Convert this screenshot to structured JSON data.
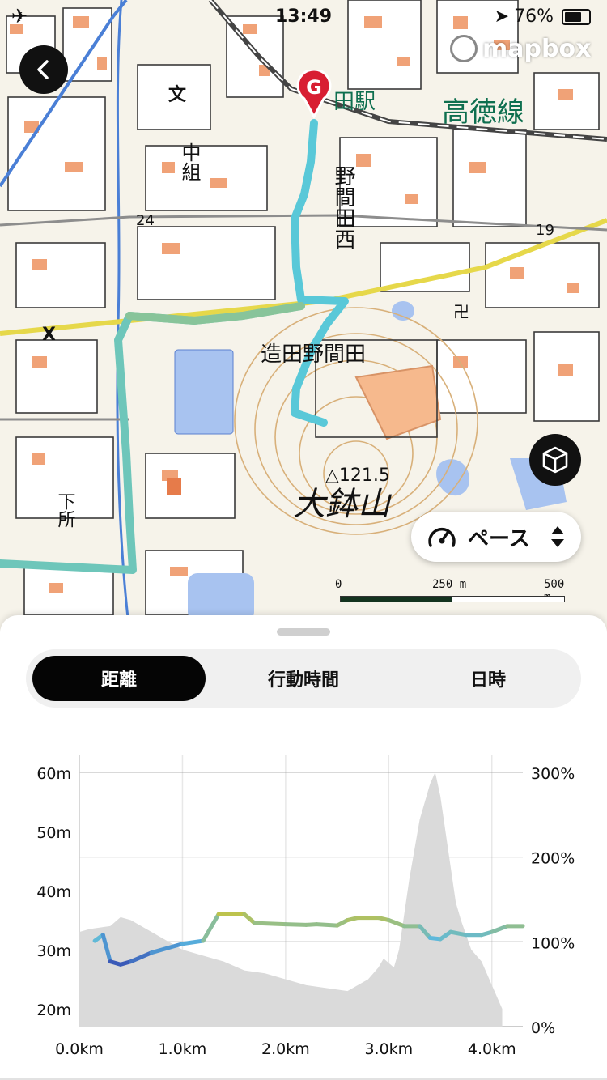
{
  "status_bar": {
    "time": "13:49",
    "battery": "76%"
  },
  "map": {
    "labels": {
      "station": "田駅",
      "line": "高徳線",
      "village": "中組",
      "district": "野間田西",
      "area": "造田野間田",
      "mountain": "大鉢山",
      "summit": "△121.5",
      "lower": "下所",
      "road_num_1": "24",
      "road_num_2": "19",
      "mark_x": "X",
      "mark_school": "文",
      "mark_temple": "卍"
    },
    "provider": "mapbox",
    "goal_marker": "G",
    "scale": {
      "zero": "0",
      "mid": "250 m",
      "max": "500 m",
      "fill_fraction": 0.5
    }
  },
  "controls": {
    "back_icon": "chevron-left-icon",
    "view3d_icon": "cube-icon",
    "pace_icon": "speedometer-icon",
    "pace_label": "ペース",
    "pace_toggle_icon": "up-down-arrows-icon"
  },
  "tabs": [
    {
      "label": "距離",
      "active": true
    },
    {
      "label": "行動時間",
      "active": false
    },
    {
      "label": "日時",
      "active": false
    }
  ],
  "chart_data": {
    "type": "area",
    "xlabel": "",
    "ylabel": "",
    "x_ticks": [
      "0.0km",
      "1.0km",
      "2.0km",
      "3.0km",
      "4.0km"
    ],
    "y_left_ticks": [
      "60m",
      "50m",
      "40m",
      "30m",
      "20m"
    ],
    "y_right_ticks": [
      "300%",
      "200%",
      "100%",
      "0%"
    ],
    "xlim": [
      0,
      4.3
    ],
    "ylim_left": [
      17,
      63
    ],
    "ylim_right": [
      0,
      300
    ],
    "grid": true,
    "series": [
      {
        "role": "slope-area",
        "color": "#dadada",
        "x": [
          0.0,
          0.1,
          0.3,
          0.4,
          0.5,
          0.7,
          1.0,
          1.2,
          1.4,
          1.6,
          1.8,
          2.0,
          2.2,
          2.4,
          2.6,
          2.7,
          2.8,
          2.9,
          2.95,
          3.05,
          3.1,
          3.2,
          3.3,
          3.4,
          3.45,
          3.5,
          3.55,
          3.6,
          3.65,
          3.7,
          3.8,
          3.9,
          4.0,
          4.05,
          4.1
        ],
        "values": [
          33,
          33.5,
          34,
          35.5,
          35,
          33,
          30,
          29,
          28,
          26.5,
          26,
          25,
          24,
          23.5,
          23,
          24,
          25,
          27,
          28.5,
          27,
          30,
          42,
          52,
          58,
          60,
          56,
          50,
          44,
          38,
          35,
          30,
          28,
          24,
          22,
          20
        ]
      },
      {
        "role": "elevation-line",
        "colors_low_to_high": [
          "#3448b0",
          "#5ab8e0",
          "#c9c43c"
        ],
        "x": [
          0.15,
          0.23,
          0.3,
          0.4,
          0.5,
          0.7,
          1.0,
          1.2,
          1.35,
          1.6,
          1.7,
          2.0,
          2.2,
          2.3,
          2.5,
          2.6,
          2.7,
          2.9,
          3.0,
          3.15,
          3.3,
          3.4,
          3.5,
          3.6,
          3.75,
          3.9,
          4.0,
          4.15,
          4.3
        ],
        "values": [
          31.5,
          32.5,
          28,
          27.5,
          28,
          29.5,
          31,
          31.5,
          36,
          36,
          34.5,
          34.3,
          34.2,
          34.3,
          34.1,
          35,
          35.4,
          35.4,
          35,
          34,
          34,
          32,
          31.8,
          33,
          32.5,
          32.5,
          33,
          34,
          34
        ]
      }
    ]
  }
}
